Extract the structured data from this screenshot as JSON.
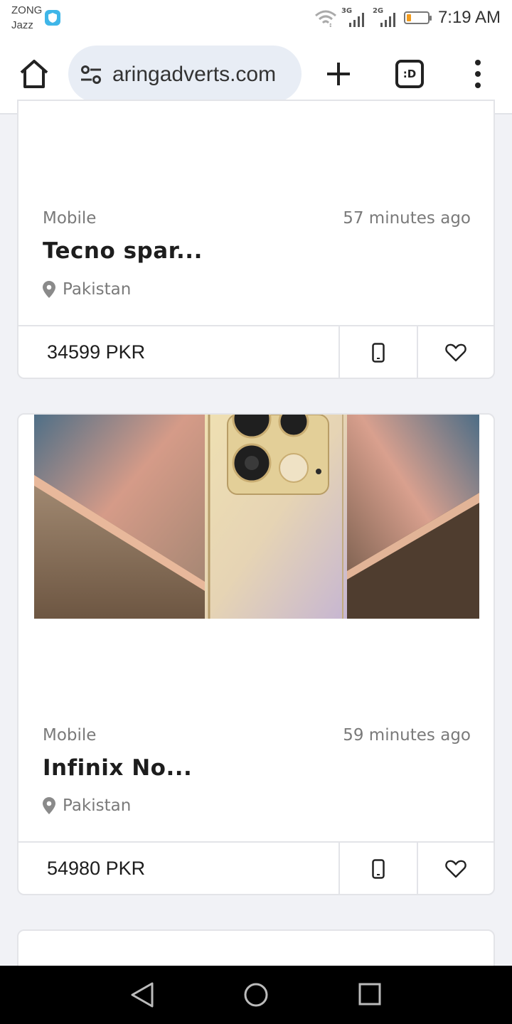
{
  "status_bar": {
    "carrier_1": "ZONG",
    "carrier_2": "Jazz",
    "network_1": "3G",
    "network_2": "2G",
    "time": "7:19 AM",
    "battery_level": 0.2
  },
  "browser": {
    "url": "aringadverts.com",
    "tabs_label": ":D"
  },
  "listings": [
    {
      "category": "Mobile",
      "time": "57 minutes ago",
      "title": "Tecno spar...",
      "location": "Pakistan",
      "price": "34599 PKR"
    },
    {
      "category": "Mobile",
      "time": "59 minutes ago",
      "title": "Infinix No...",
      "location": "Pakistan",
      "price": "54980 PKR"
    }
  ],
  "colors": {
    "page_bg": "#f1f2f6",
    "card_border": "#e3e4e8",
    "url_bar_bg": "#e8edf5",
    "muted_text": "#7a7a7a",
    "vpn_blue": "#3fb6e8",
    "battery_orange": "#f29b1d"
  },
  "icons": [
    "vpn-shield-icon",
    "wifi-icon",
    "signal-icon",
    "battery-icon",
    "home-icon",
    "site-settings-icon",
    "plus-icon",
    "menu-dots-icon",
    "location-pin-icon",
    "phone-icon",
    "heart-icon",
    "back-icon",
    "home-circle-icon",
    "recents-icon"
  ]
}
